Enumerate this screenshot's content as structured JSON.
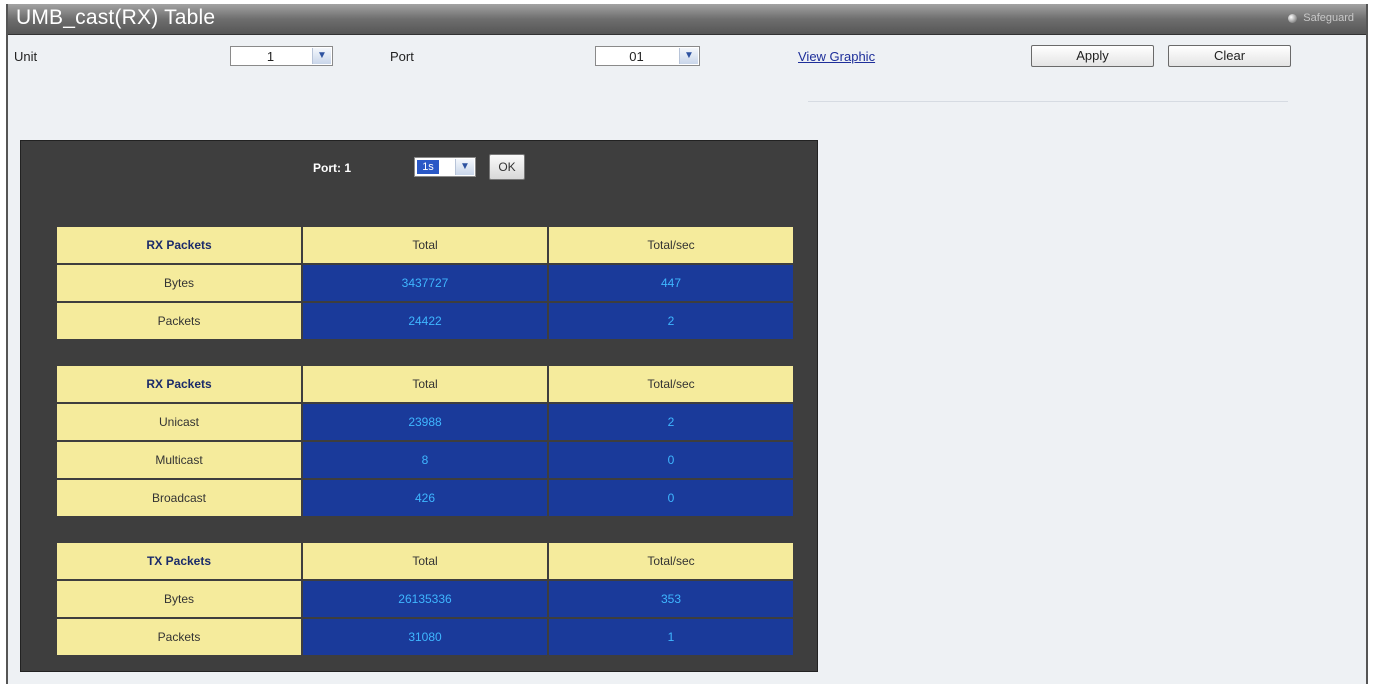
{
  "window": {
    "title": "UMB_cast(RX) Table",
    "safeguard": "Safeguard"
  },
  "toolbar": {
    "unit_label": "Unit",
    "unit_value": "1",
    "port_label": "Port",
    "port_value": "01",
    "view_graphic": "View Graphic",
    "apply": "Apply",
    "clear": "Clear"
  },
  "panel": {
    "port_text": "Port: 1",
    "interval_value": "1s",
    "ok": "OK"
  },
  "tables": [
    {
      "header": [
        "RX Packets",
        "Total",
        "Total/sec"
      ],
      "rows": [
        [
          "Bytes",
          "3437727",
          "447"
        ],
        [
          "Packets",
          "24422",
          "2"
        ]
      ]
    },
    {
      "header": [
        "RX Packets",
        "Total",
        "Total/sec"
      ],
      "rows": [
        [
          "Unicast",
          "23988",
          "2"
        ],
        [
          "Multicast",
          "8",
          "0"
        ],
        [
          "Broadcast",
          "426",
          "0"
        ]
      ]
    },
    {
      "header": [
        "TX Packets",
        "Total",
        "Total/sec"
      ],
      "rows": [
        [
          "Bytes",
          "26135336",
          "353"
        ],
        [
          "Packets",
          "31080",
          "1"
        ]
      ]
    }
  ]
}
